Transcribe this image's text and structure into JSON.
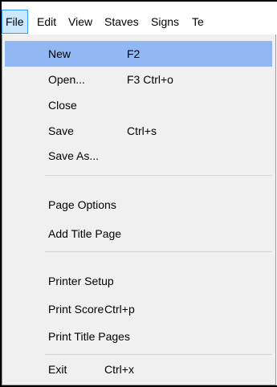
{
  "menubar": {
    "items": [
      {
        "label": "File"
      },
      {
        "label": "Edit"
      },
      {
        "label": "View"
      },
      {
        "label": "Staves"
      },
      {
        "label": "Signs"
      },
      {
        "label": "Te"
      }
    ]
  },
  "file_menu": {
    "items": [
      {
        "label": "New",
        "shortcut": "F2"
      },
      {
        "label": "Open...",
        "shortcut": "F3 Ctrl+o"
      },
      {
        "label": "Close",
        "shortcut": ""
      },
      {
        "label": "Save",
        "shortcut": "Ctrl+s"
      },
      {
        "label": "Save As...",
        "shortcut": ""
      },
      {
        "label": "Page Options",
        "shortcut": ""
      },
      {
        "label": "Add Title Page",
        "shortcut": ""
      },
      {
        "label": "Printer Setup",
        "shortcut": ""
      },
      {
        "label": "Print Score",
        "shortcut": "Ctrl+p"
      },
      {
        "label": "Print Title Pages",
        "shortcut": ""
      },
      {
        "label": "Exit",
        "shortcut": "Ctrl+x"
      }
    ]
  }
}
